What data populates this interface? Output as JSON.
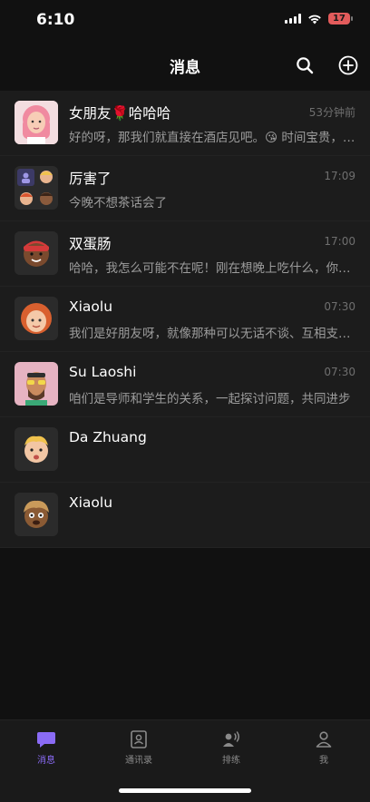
{
  "status_bar": {
    "time": "6:10",
    "battery": "17"
  },
  "header": {
    "title": "消息"
  },
  "conversations": [
    {
      "name": "女朋友🌹哈哈哈",
      "time": "53分钟前",
      "preview": "好的呀，那我们就直接在酒店见吧。😘 时间宝贵，我们不要浪费时间啦"
    },
    {
      "name": "厉害了",
      "time": "17:09",
      "preview": "今晚不想茶话会了"
    },
    {
      "name": "双蛋肠",
      "time": "17:00",
      "preview": "哈哈，我怎么可能不在呢！刚在想晚上吃什么，你有推荐吗"
    },
    {
      "name": "Xiaolu",
      "time": "07:30",
      "preview": "我们是好朋友呀，就像那种可以无话不谈、互相支持的朋友"
    },
    {
      "name": "Su Laoshi",
      "time": "07:30",
      "preview": "咱们是导师和学生的关系，一起探讨问题，共同进步"
    },
    {
      "name": "Da Zhuang",
      "time": "",
      "preview": ""
    },
    {
      "name": "Xiaolu",
      "time": "",
      "preview": ""
    }
  ],
  "tabs": [
    {
      "label": "消息",
      "icon": "chat-bubble-icon",
      "active": true
    },
    {
      "label": "通讯录",
      "icon": "contacts-icon",
      "active": false
    },
    {
      "label": "排练",
      "icon": "voice-person-icon",
      "active": false
    },
    {
      "label": "我",
      "icon": "person-icon",
      "active": false
    }
  ],
  "colors": {
    "accent": "#8a6bf5",
    "background": "#111111",
    "row": "#1c1c1c",
    "battery": "#e35b5b"
  }
}
